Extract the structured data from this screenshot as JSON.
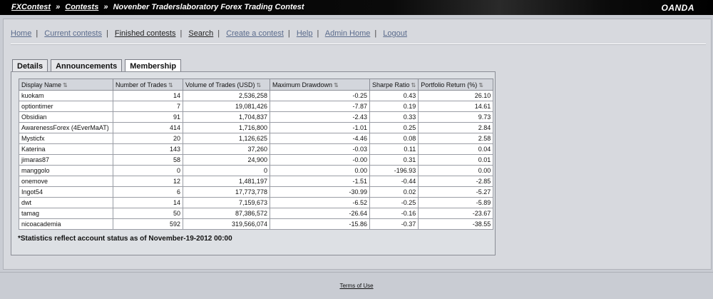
{
  "breadcrumb": {
    "items": [
      "FXContest",
      "Contests",
      "Novenber Traderslaboratory Forex Trading Contest"
    ],
    "separator": "»"
  },
  "brand": "OANDA",
  "nav": {
    "links": [
      "Home",
      "Current contests",
      "Finished contests",
      "Search",
      "Create a contest",
      "Help",
      "Admin Home",
      "Logout"
    ],
    "separator": "|"
  },
  "tabs": [
    "Details",
    "Announcements",
    "Membership"
  ],
  "table": {
    "headers": [
      "Display Name",
      "Number of Trades",
      "Volume of Trades (USD)",
      "Maximum Drawdown",
      "Sharpe Ratio",
      "Portfolio Return (%)"
    ],
    "sort_icon": "⇅",
    "rows": [
      [
        "kuokam",
        "14",
        "2,536,258",
        "-0.25",
        "0.43",
        "26.10"
      ],
      [
        "optiontimer",
        "7",
        "19,081,426",
        "-7.87",
        "0.19",
        "14.61"
      ],
      [
        "Obsidian",
        "91",
        "1,704,837",
        "-2.43",
        "0.33",
        "9.73"
      ],
      [
        "AwarenessForex (4EverMaAT)",
        "414",
        "1,716,800",
        "-1.01",
        "0.25",
        "2.84"
      ],
      [
        "Mysticfx",
        "20",
        "1,126,625",
        "-4.46",
        "0.08",
        "2.58"
      ],
      [
        "Katerina",
        "143",
        "37,260",
        "-0.03",
        "0.11",
        "0.04"
      ],
      [
        "jimaras87",
        "58",
        "24,900",
        "-0.00",
        "0.31",
        "0.01"
      ],
      [
        "manggolo",
        "0",
        "0",
        "0.00",
        "-196.93",
        "0.00"
      ],
      [
        "onemove",
        "12",
        "1,481,197",
        "-1.51",
        "-0.44",
        "-2.85"
      ],
      [
        "Ingot54",
        "6",
        "17,773,778",
        "-30.99",
        "0.02",
        "-5.27"
      ],
      [
        "dwt",
        "14",
        "7,159,673",
        "-6.52",
        "-0.25",
        "-5.89"
      ],
      [
        "tamag",
        "50",
        "87,386,572",
        "-26.64",
        "-0.16",
        "-23.67"
      ],
      [
        "nicoacademia",
        "592",
        "319,566,074",
        "-15.86",
        "-0.37",
        "-38.55"
      ]
    ]
  },
  "note": "*Statistics reflect account status as of November-19-2012 00:00",
  "footer": {
    "terms": "Terms of Use"
  }
}
